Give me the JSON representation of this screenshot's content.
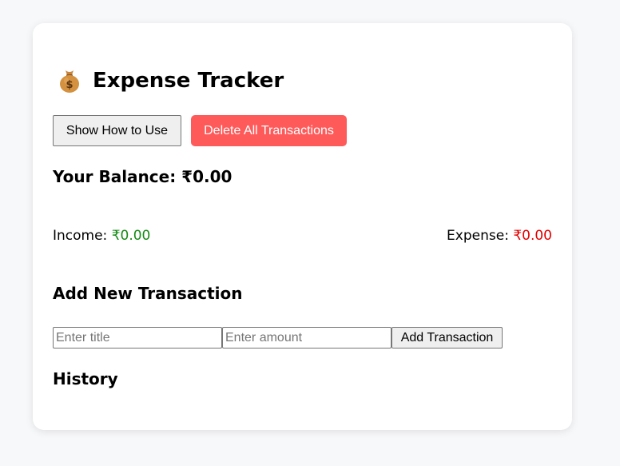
{
  "app": {
    "title": "Expense Tracker",
    "icon": "money-bag-icon"
  },
  "actions": {
    "how_to_use_label": "Show How to Use",
    "delete_all_label": "Delete All Transactions"
  },
  "balance": {
    "label": "Your Balance: ",
    "value": "₹0.00"
  },
  "summary": {
    "income_label": "Income: ",
    "income_value": "₹0.00",
    "expense_label": "Expense: ",
    "expense_value": "₹0.00"
  },
  "add_transaction": {
    "heading": "Add New Transaction",
    "title_placeholder": "Enter title",
    "title_value": "",
    "amount_placeholder": "Enter amount",
    "amount_value": "",
    "submit_label": "Add Transaction"
  },
  "history": {
    "heading": "History",
    "items": []
  },
  "colors": {
    "background": "#f7f8fa",
    "card": "#ffffff",
    "delete_button": "#ff5a5a",
    "income": "#148a14",
    "expense": "#e60000"
  }
}
